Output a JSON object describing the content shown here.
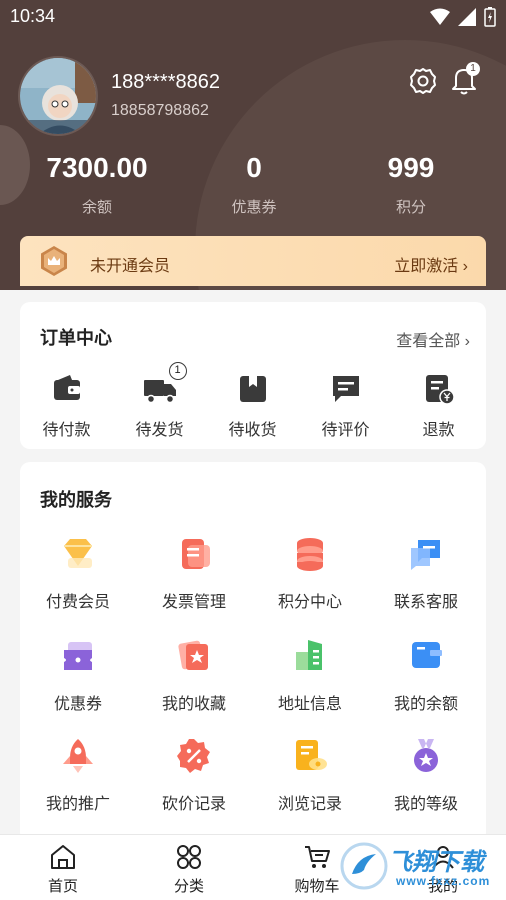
{
  "status_bar": {
    "time": "10:34"
  },
  "profile": {
    "username": "188****8862",
    "phone": "18858798862",
    "notification_count": "1"
  },
  "stats": [
    {
      "value": "7300.00",
      "label": "余额"
    },
    {
      "value": "0",
      "label": "优惠券"
    },
    {
      "value": "999",
      "label": "积分"
    }
  ],
  "vip": {
    "text": "未开通会员",
    "action": "立即激活 ›"
  },
  "orders": {
    "title": "订单中心",
    "view_all": "查看全部 ›",
    "items": [
      {
        "label": "待付款",
        "icon": "wallet-icon"
      },
      {
        "label": "待发货",
        "icon": "truck-icon",
        "badge": "1"
      },
      {
        "label": "待收货",
        "icon": "package-icon"
      },
      {
        "label": "待评价",
        "icon": "comment-icon"
      },
      {
        "label": "退款",
        "icon": "refund-icon"
      }
    ]
  },
  "services": {
    "title": "我的服务",
    "items": [
      {
        "label": "付费会员",
        "icon": "diamond-icon"
      },
      {
        "label": "发票管理",
        "icon": "invoice-icon"
      },
      {
        "label": "积分中心",
        "icon": "coins-icon"
      },
      {
        "label": "联系客服",
        "icon": "chat-icon"
      },
      {
        "label": "优惠券",
        "icon": "ticket-icon"
      },
      {
        "label": "我的收藏",
        "icon": "favorite-icon"
      },
      {
        "label": "地址信息",
        "icon": "address-icon"
      },
      {
        "label": "我的余额",
        "icon": "balance-icon"
      },
      {
        "label": "我的推广",
        "icon": "rocket-icon"
      },
      {
        "label": "砍价记录",
        "icon": "discount-icon"
      },
      {
        "label": "浏览记录",
        "icon": "history-icon"
      },
      {
        "label": "我的等级",
        "icon": "medal-icon"
      }
    ]
  },
  "tabbar": [
    {
      "label": "首页",
      "icon": "home-icon"
    },
    {
      "label": "分类",
      "icon": "grid-icon"
    },
    {
      "label": "购物车",
      "icon": "cart-icon"
    },
    {
      "label": "我的",
      "icon": "user-icon"
    }
  ],
  "watermark": {
    "text": "飞翔下载",
    "url": "www.fxxz.com"
  },
  "colors": {
    "header": "#53403c",
    "vip_bg": "#fde3bf",
    "vip_text": "#6b3a12"
  }
}
